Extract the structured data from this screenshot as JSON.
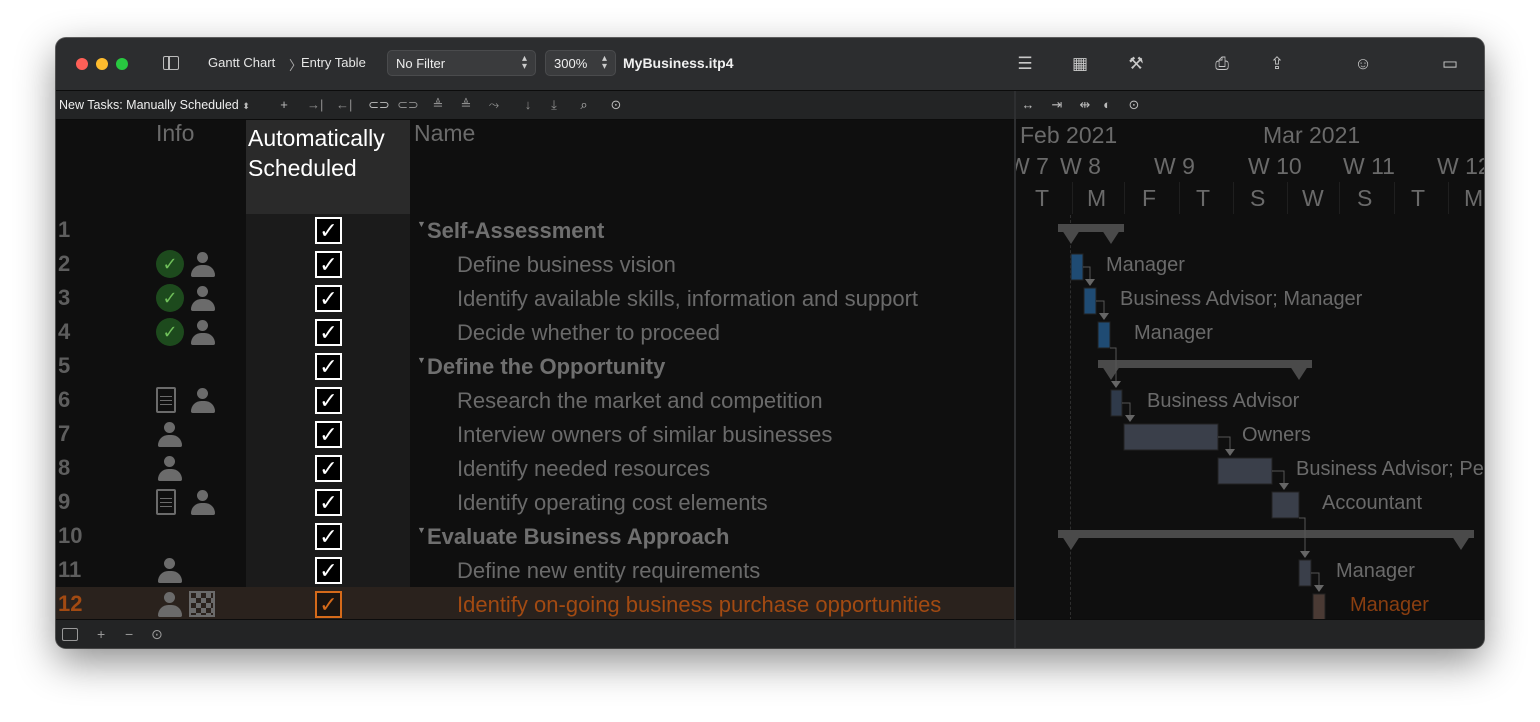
{
  "window": {
    "breadcrumb": [
      "Gantt Chart",
      "Entry Table"
    ],
    "filter_value": "No Filter",
    "zoom_value": "300%",
    "document_title": "MyBusiness.itp4"
  },
  "toolbar2": {
    "new_tasks_label": "New Tasks: Manually Scheduled"
  },
  "table": {
    "headers": {
      "info": "Info",
      "auto": "Automatically Scheduled",
      "name": "Name"
    },
    "rows": [
      {
        "num": "1",
        "name": "Self-Assessment",
        "group": true,
        "icons": [],
        "done": false
      },
      {
        "num": "2",
        "name": "Define business vision",
        "group": false,
        "icons": [
          "check-icon",
          "person-icon"
        ]
      },
      {
        "num": "3",
        "name": "Identify available skills, information and support",
        "group": false,
        "icons": [
          "check-icon",
          "person-icon"
        ]
      },
      {
        "num": "4",
        "name": "Decide whether to proceed",
        "group": false,
        "icons": [
          "check-icon",
          "person-icon"
        ]
      },
      {
        "num": "5",
        "name": "Define the Opportunity",
        "group": true,
        "icons": []
      },
      {
        "num": "6",
        "name": "Research the market and competition",
        "group": false,
        "icons": [
          "note-icon",
          "person-icon"
        ]
      },
      {
        "num": "7",
        "name": "Interview owners of similar businesses",
        "group": false,
        "icons": [
          "person-icon"
        ]
      },
      {
        "num": "8",
        "name": "Identify needed resources",
        "group": false,
        "icons": [
          "person-icon"
        ]
      },
      {
        "num": "9",
        "name": "Identify operating cost elements",
        "group": false,
        "icons": [
          "note-icon",
          "person-icon"
        ]
      },
      {
        "num": "10",
        "name": "Evaluate Business Approach",
        "group": true,
        "icons": []
      },
      {
        "num": "11",
        "name": "Define new entity requirements",
        "group": false,
        "icons": [
          "person-icon"
        ]
      },
      {
        "num": "12",
        "name": "Identify on-going business purchase opportunities",
        "group": false,
        "icons": [
          "person-icon",
          "grid-icon"
        ]
      }
    ]
  },
  "gantt": {
    "months": [
      "Feb 2021",
      "Mar 2021"
    ],
    "weeks": [
      "W 7",
      "W 8",
      "W 9",
      "W 10",
      "W 11",
      "W 12"
    ],
    "days": [
      "T",
      "M",
      "F",
      "T",
      "S",
      "W",
      "S",
      "T",
      "M"
    ],
    "labels": [
      "Manager",
      "Business Advisor; Manager",
      "Manager",
      "Business Advisor",
      "Owners",
      "Business Advisor; Pe",
      "Accountant",
      "Manager",
      "Manager"
    ]
  },
  "colors": {
    "selection": "#d56a1a",
    "task_bar_done": "#1f4b73",
    "task_bar": "#3a3f4a",
    "group_bar": "#4a4a4a"
  }
}
